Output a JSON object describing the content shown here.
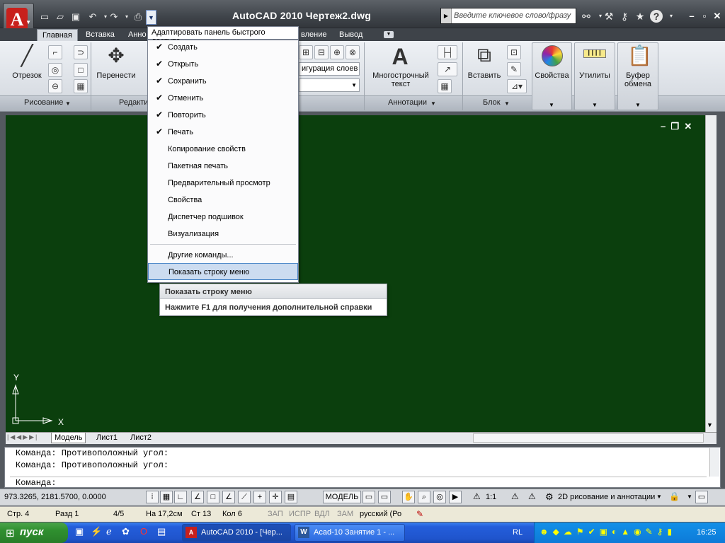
{
  "window": {
    "title": "AutoCAD 2010    Чертеж2.dwg"
  },
  "search": {
    "placeholder": "Введите ключевое слово/фразу"
  },
  "ribbon": {
    "tabs": [
      "Главная",
      "Вставка",
      "Анно",
      "вление",
      "Вывод"
    ],
    "buttons": {
      "line": "Отрезок",
      "move": "Перенести",
      "mtext": "Многострочный текст",
      "insert": "Вставить",
      "properties": "Свойства",
      "utilities": "Утилиты",
      "clipboard": "Буфер обмена",
      "layer_config": "игурация слоев"
    },
    "panels": {
      "draw": "Рисование",
      "modify": "Редакти",
      "annotations": "Аннотации",
      "block": "Блок"
    }
  },
  "qat_menu": {
    "header": "Адаптировать панель быстрого доступа",
    "items": [
      {
        "label": "Создать",
        "checked": true
      },
      {
        "label": "Открыть",
        "checked": true
      },
      {
        "label": "Сохранить",
        "checked": true
      },
      {
        "label": "Отменить",
        "checked": true
      },
      {
        "label": "Повторить",
        "checked": true
      },
      {
        "label": "Печать",
        "checked": true
      },
      {
        "label": "Копирование свойств",
        "checked": false
      },
      {
        "label": "Пакетная печать",
        "checked": false
      },
      {
        "label": "Предварительный просмотр",
        "checked": false
      },
      {
        "label": "Свойства",
        "checked": false
      },
      {
        "label": "Диспетчер подшивок",
        "checked": false
      },
      {
        "label": "Визуализация",
        "checked": false
      }
    ],
    "more": "Другие команды...",
    "show_menubar": "Показать строку меню",
    "check_mark": "✔"
  },
  "tooltip": {
    "title": "Показать строку меню",
    "help": "Нажмите F1 для получения дополнительной справки"
  },
  "ucs": {
    "y": "Y",
    "x": "X"
  },
  "sheets": [
    "Модель",
    "Лист1",
    "Лист2"
  ],
  "command": {
    "history": [
      "Команда: Противоположный угол:",
      "Команда: Противоположный угол:"
    ],
    "prompt": "Команда:"
  },
  "statusbar": {
    "coords": "973.3265, 2181.5700, 0.0000",
    "model": "МОДЕЛЬ",
    "scale": "1:1",
    "workspace": "2D рисование и аннотации"
  },
  "docbar": {
    "page": "Стр. 4",
    "section": "Разд 1",
    "pages": "4/5",
    "at": "На 17,2см",
    "line": "Ст 13",
    "col": "Кол 6",
    "rec": "ЗАП",
    "fix": "ИСПР",
    "ext": "ВДЛ",
    "ovr": "ЗАМ",
    "lang": "русский (Ро"
  },
  "taskbar": {
    "start": "пуск",
    "tasks": [
      "AutoCAD 2010 - [Чер...",
      "Acad-10 Занятие 1 - ..."
    ],
    "lang": "RL",
    "clock": "16:25"
  },
  "colors": {
    "drawing_bg": "#0b3f0d",
    "highlight": "#ccdcf0",
    "taskbar": "#245edb"
  }
}
